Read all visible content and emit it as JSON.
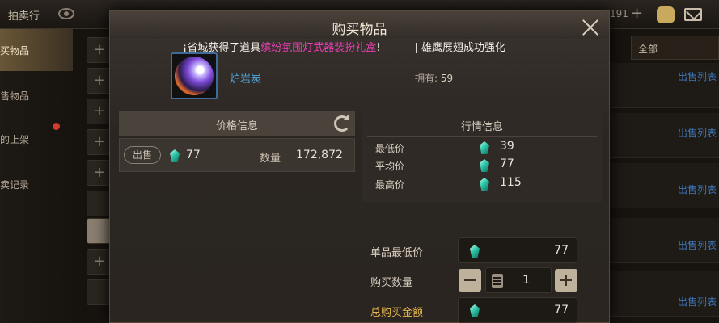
{
  "background": {
    "title": "拍卖行",
    "right_info": "191",
    "sidebar": [
      "买物品",
      "售物品",
      "的上架",
      "卖记录"
    ],
    "filter": "全部",
    "row_link": "出售列表"
  },
  "dialog": {
    "title": "购买物品",
    "marquee": {
      "prefix": "¡省城获得了道具",
      "highlight": "缤纷氛围灯武器装扮礼盒",
      "suffix": "!",
      "second": "| 雄鹰展翅成功强化"
    },
    "item": {
      "name": "炉岩炭",
      "owned_label": "拥有:",
      "owned_value": "59"
    },
    "price_panel": {
      "title": "价格信息",
      "listing": {
        "badge": "出售",
        "price": "77",
        "qty_label": "数量",
        "qty": "172,872"
      }
    },
    "market": {
      "title": "行情信息",
      "rows": [
        {
          "label": "最低价",
          "value": "39"
        },
        {
          "label": "平均价",
          "value": "77"
        },
        {
          "label": "最高价",
          "value": "115"
        }
      ]
    },
    "form": {
      "unit_price_label": "单品最低价",
      "unit_price": "77",
      "qty_label": "购买数量",
      "qty": "1",
      "total_label": "总购买金额",
      "total": "77"
    }
  },
  "colors": {
    "accent_gold": "#e8b84a",
    "item_name_blue": "#4ea5d8",
    "marquee_pink": "#ea3fb5",
    "gem_teal": "#2ec7a8"
  }
}
